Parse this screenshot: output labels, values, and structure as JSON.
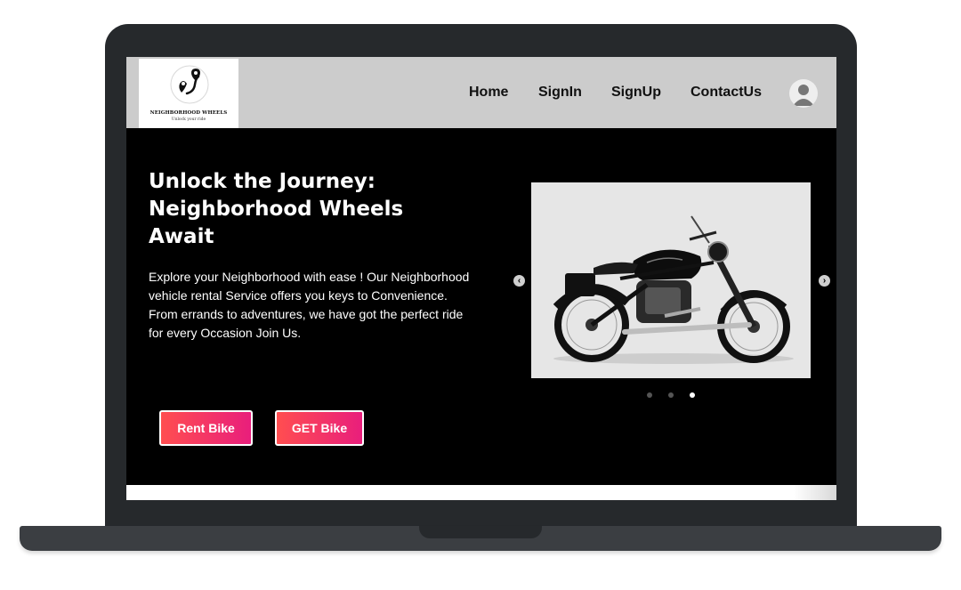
{
  "brand": {
    "name": "NEIGHBORHOOD WHEELS",
    "tagline": "Unlock your ride"
  },
  "nav": {
    "items": [
      {
        "label": "Home"
      },
      {
        "label": "SignIn"
      },
      {
        "label": "SignUp"
      },
      {
        "label": "ContactUs"
      }
    ],
    "avatar_icon": "user-avatar-icon"
  },
  "hero": {
    "title": "Unlock the Journey: Neighborhood Wheels Await",
    "description": "Explore your Neighborhood with ease ! Our Neighborhood vehicle rental Service offers you keys to Convenience. From errands to adventures, we have got the perfect ride for every Occasion Join Us.",
    "buttons": {
      "rent_label": "Rent Bike",
      "get_label": "GET Bike"
    }
  },
  "carousel": {
    "prev_icon": "chevron-left-icon",
    "next_icon": "chevron-right-icon",
    "slide_count": 3,
    "active_slide": 3,
    "image": "motorcycle-photo"
  },
  "colors": {
    "nav_bg": "#cccccc",
    "hero_bg": "#000000",
    "button_gradient_start": "#ff4e50",
    "button_gradient_end": "#e91e7c",
    "frame": "#26292c"
  }
}
